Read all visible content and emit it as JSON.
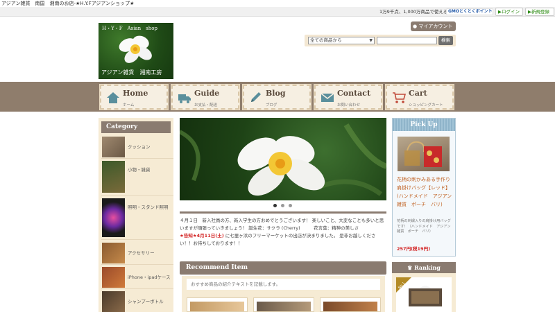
{
  "topbar": {
    "text": "アジアン雑貨　南国　湘南のお店-★H.Y.Fアジアンショップ★"
  },
  "promo": {
    "text": "1万9千点、1,000万商品で使える",
    "gmo": "GMOとくとくポイント",
    "login": "▶ログイン",
    "signup": "▶新規登録"
  },
  "logo": {
    "top": "H・Y・F　Asian　shop",
    "bottom": "アジアン雑貨　湘南工房"
  },
  "header": {
    "my_account": "マイアカウント",
    "search_select": "全ての商品から",
    "search_placeholder": "",
    "search_button": "検索"
  },
  "nav": [
    {
      "title": "Home",
      "sub": "ホーム",
      "icon": "house-icon",
      "color": "#5a8f9c"
    },
    {
      "title": "Guide",
      "sub": "お支払・配送",
      "icon": "truck-icon",
      "color": "#5a8f9c"
    },
    {
      "title": "Blog",
      "sub": "ブログ",
      "icon": "pencil-icon",
      "color": "#5a8f9c"
    },
    {
      "title": "Contact",
      "sub": "お問い合わせ",
      "icon": "envelope-icon",
      "color": "#5a8f9c"
    },
    {
      "title": "Cart",
      "sub": "ショッピングカート",
      "icon": "cart-icon",
      "color": "#c04a3a"
    }
  ],
  "sidebar": {
    "title": "Category",
    "items": [
      {
        "label": "クッション"
      },
      {
        "label": "小物・雑貨"
      },
      {
        "label": "照明・スタンド照明"
      },
      {
        "label": "アクセサリー"
      },
      {
        "label": "iPhone・ipadケース"
      },
      {
        "label": "シャンプーボトル"
      }
    ]
  },
  "news": {
    "line1": "４月１日　新入社員の方、新入学生の方おめでとうございます！ 楽しいこと、大変なことも多いと思いますが頑張っていきましょう！ 誕生花：サクラ (Cherry)　　　花言葉：精神の美しさ",
    "notice": "★告知★4月11日(土)",
    "line2": " に七里ヶ浜のフリーマーケットの出店が決まりました。 是非お越しください！！お待ちしております！！"
  },
  "recommend": {
    "title": "Recommend Item",
    "intro": "おすすめ商品の紹介テキストを記載します。"
  },
  "pickup": {
    "title": "Pick Up",
    "name": "花柄の刺かみある手作り肩掛けバッグ【レッド】(ハンドメイド　アジアン雑貨　ポーチ　バリ)",
    "desc": "花柄の刺繍入りの肩掛け用バッグです！（ハンドメイド　アジアン雑貨　ポーチ　バリ）",
    "price": "257円(税19円)"
  },
  "ranking": {
    "title": "Ranking",
    "badge": "No.1"
  },
  "slider": {
    "active": 1,
    "count": 3
  }
}
